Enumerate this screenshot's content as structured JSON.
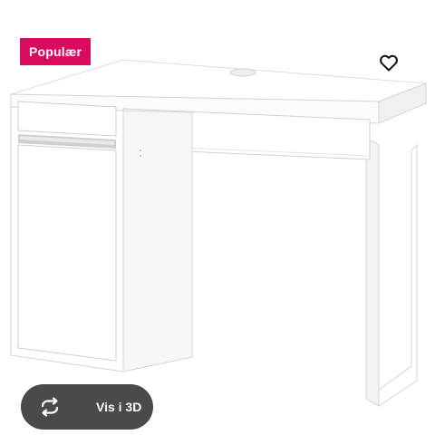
{
  "product": {
    "badge_label": "Populær",
    "view_3d_label": "Vis i 3D",
    "image_icon": "desk-illustration"
  },
  "colors": {
    "badge_bg": "#d90b5f",
    "button_bg": "#4a4a4a",
    "heart_stroke": "#111111"
  },
  "icons": {
    "favourite": "heart-outline-icon",
    "view_3d": "rotate-arrows-icon"
  }
}
